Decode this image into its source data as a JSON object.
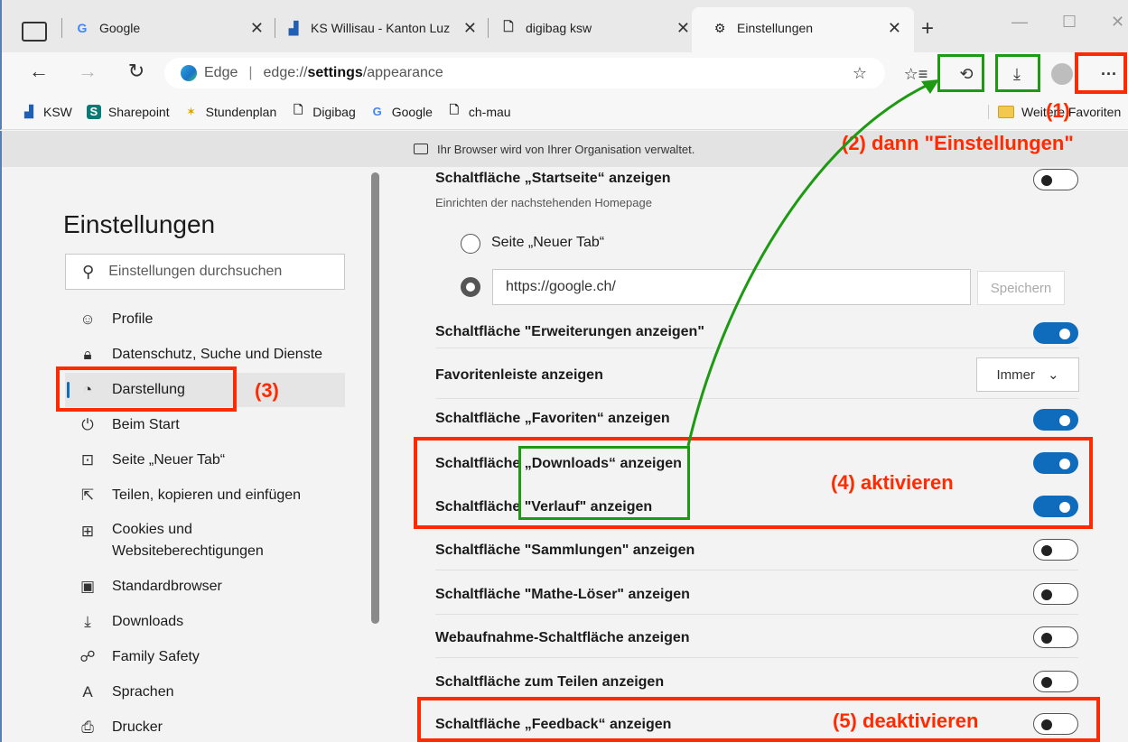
{
  "tabs": [
    {
      "label": "Google",
      "favicon": "G"
    },
    {
      "label": "KS Willisau - Kanton Luz",
      "favicon": "▟"
    },
    {
      "label": "digibag ksw",
      "favicon": "🗋"
    },
    {
      "label": "Einstellungen",
      "favicon": "⚙"
    }
  ],
  "address": {
    "site": "Edge",
    "url_prefix": "edge://",
    "url_host": "settings",
    "url_path": "/appearance"
  },
  "bookmarks": [
    {
      "label": "KSW",
      "icon": "▟"
    },
    {
      "label": "Sharepoint",
      "icon": "S"
    },
    {
      "label": "Stundenplan",
      "icon": "✶"
    },
    {
      "label": "Digibag",
      "icon": "🗋"
    },
    {
      "label": "Google",
      "icon": "G"
    },
    {
      "label": "ch-mau",
      "icon": "🗋"
    }
  ],
  "other_favorites": "Weitere Favoriten",
  "banner_text": "Ihr Browser wird von Ihrer Organisation verwaltet.",
  "sidebar": {
    "title": "Einstellungen",
    "search_placeholder": "Einstellungen durchsuchen",
    "items": [
      {
        "label": "Profile",
        "icon": "person-icon"
      },
      {
        "label": "Datenschutz, Suche und Dienste",
        "icon": "lock-icon"
      },
      {
        "label": "Darstellung",
        "icon": "palette-icon"
      },
      {
        "label": "Beim Start",
        "icon": "power-icon"
      },
      {
        "label": "Seite „Neuer Tab“",
        "icon": "newtab-icon"
      },
      {
        "label": "Teilen, kopieren und einfügen",
        "icon": "share-icon"
      },
      {
        "label": "Cookies und",
        "label2": "Websiteberechtigungen",
        "icon": "cookie-icon"
      },
      {
        "label": "Standardbrowser",
        "icon": "browser-icon"
      },
      {
        "label": "Downloads",
        "icon": "download-icon"
      },
      {
        "label": "Family Safety",
        "icon": "family-icon"
      },
      {
        "label": "Sprachen",
        "icon": "language-icon"
      },
      {
        "label": "Drucker",
        "icon": "printer-icon"
      }
    ]
  },
  "settings": {
    "home_button": {
      "label": "Schaltfläche „Startseite“ anzeigen",
      "sub": "Einrichten der nachstehenden Homepage",
      "on": false
    },
    "radio_newtab": "Seite „Neuer Tab“",
    "home_url": "https://google.ch/",
    "save_label": "Speichern",
    "extensions": {
      "label": "Schaltfläche \"Erweiterungen anzeigen\"",
      "on": true
    },
    "favbar": {
      "label": "Favoritenleiste anzeigen",
      "value": "Immer"
    },
    "favorites": {
      "label": "Schaltfläche „Favoriten“ anzeigen",
      "on": true
    },
    "downloads": {
      "label": "Schaltfläche „Downloads“ anzeigen",
      "on": true
    },
    "history": {
      "label": "Schaltfläche \"Verlauf\" anzeigen",
      "on": true
    },
    "collections": {
      "label": "Schaltfläche \"Sammlungen\" anzeigen",
      "on": false
    },
    "math": {
      "label": "Schaltfläche \"Mathe-Löser\" anzeigen",
      "on": false
    },
    "webcapture": {
      "label": "Webaufnahme-Schaltfläche anzeigen",
      "on": false
    },
    "share": {
      "label": "Schaltfläche zum Teilen anzeigen",
      "on": false
    },
    "feedback": {
      "label": "Schaltfläche „Feedback“ anzeigen",
      "on": false
    }
  },
  "annotations": {
    "a1": "(1)",
    "a2": "(2)  dann \"Einstellungen\"",
    "a3": "(3)",
    "a4": "(4)  aktivieren",
    "a5": "(5)  deaktivieren",
    "red_color": "#ff2a00",
    "green_color": "#1c9a12"
  }
}
